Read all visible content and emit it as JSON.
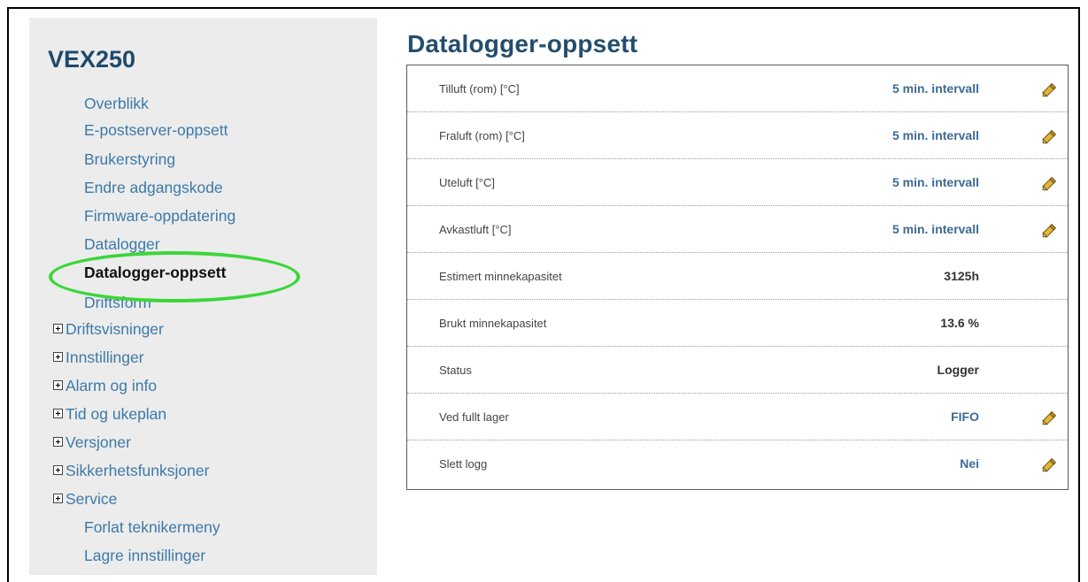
{
  "sidebar": {
    "title": "VEX250",
    "items": [
      {
        "label": "Overblikk",
        "expandable": false,
        "active": false
      },
      {
        "label": "E-postserver-oppsett",
        "expandable": false,
        "active": false
      },
      {
        "label": "Brukerstyring",
        "expandable": false,
        "active": false
      },
      {
        "label": "Endre adgangskode",
        "expandable": false,
        "active": false
      },
      {
        "label": "Firmware-oppdatering",
        "expandable": false,
        "active": false
      },
      {
        "label": "Datalogger",
        "expandable": false,
        "active": false
      },
      {
        "label": "Datalogger-oppsett",
        "expandable": false,
        "active": true
      },
      {
        "label": "Driftsform",
        "expandable": false,
        "active": false
      },
      {
        "label": "Driftsvisninger",
        "expandable": true,
        "active": false
      },
      {
        "label": "Innstillinger",
        "expandable": true,
        "active": false
      },
      {
        "label": "Alarm og info",
        "expandable": true,
        "active": false
      },
      {
        "label": "Tid og ukeplan",
        "expandable": true,
        "active": false
      },
      {
        "label": "Versjoner",
        "expandable": true,
        "active": false
      },
      {
        "label": "Sikkerhetsfunksjoner",
        "expandable": true,
        "active": false
      },
      {
        "label": "Service",
        "expandable": true,
        "active": false
      },
      {
        "label": "Forlat teknikermeny",
        "expandable": false,
        "active": false
      },
      {
        "label": "Lagre innstillinger",
        "expandable": false,
        "active": false
      }
    ]
  },
  "main": {
    "title": "Datalogger-oppsett",
    "rows": [
      {
        "label": "Tilluft (rom) [°C]",
        "value": "5 min. intervall",
        "editable": true
      },
      {
        "label": "Fraluft (rom) [°C]",
        "value": "5 min. intervall",
        "editable": true
      },
      {
        "label": "Uteluft [°C]",
        "value": "5 min. intervall",
        "editable": true
      },
      {
        "label": "Avkastluft [°C]",
        "value": "5 min. intervall",
        "editable": true
      },
      {
        "label": "Estimert minnekapasitet",
        "value": "3125h",
        "editable": false
      },
      {
        "label": "Brukt minnekapasitet",
        "value": "13.6 %",
        "editable": false
      },
      {
        "label": "Status",
        "value": "Logger",
        "editable": false
      },
      {
        "label": "Ved fullt lager",
        "value": "FIFO",
        "editable": true
      },
      {
        "label": "Slett logg",
        "value": "Nei",
        "editable": true
      }
    ]
  },
  "colors": {
    "accent_link": "#3c79a8",
    "title": "#244d6e",
    "highlight_ring": "#3bd63b",
    "sidebar_bg": "#ececec"
  },
  "icons": {
    "edit": "pencil-icon",
    "expand": "plus-box-icon"
  }
}
